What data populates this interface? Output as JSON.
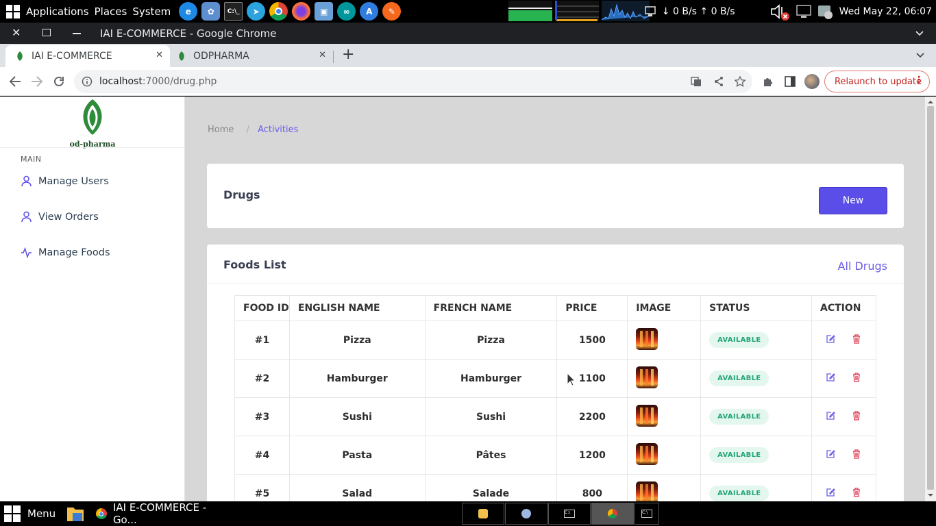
{
  "system_panel": {
    "menus": [
      "Applications",
      "Places",
      "System"
    ],
    "network": "↓ 0 B/s ↑ 0 B/s",
    "datetime": "Wed May 22, 06:07"
  },
  "window": {
    "title": "IAI E-COMMERCE - Google Chrome"
  },
  "tabs": [
    {
      "label": "IAI E-COMMERCE"
    },
    {
      "label": "ODPHARMA"
    }
  ],
  "address_bar": {
    "host": "localhost",
    "path": ":7000/drug.php",
    "relaunch_label": "Relaunch to update"
  },
  "sidebar": {
    "logo_text": "od-pharma",
    "section": "MAIN",
    "items": [
      {
        "label": "Manage Users",
        "icon": "user-icon"
      },
      {
        "label": "View Orders",
        "icon": "user-icon"
      },
      {
        "label": "Manage Foods",
        "icon": "activity-icon"
      }
    ]
  },
  "breadcrumb": {
    "home": "Home",
    "separator": "/",
    "current": "Activities"
  },
  "header_card": {
    "title": "Drugs",
    "new_button": "New"
  },
  "list_card": {
    "title": "Foods List",
    "link": "All Drugs",
    "columns": [
      "FOOD ID",
      "ENGLISH NAME",
      "FRENCH NAME",
      "PRICE",
      "IMAGE",
      "STATUS",
      "ACTION"
    ],
    "rows": [
      {
        "id": "#1",
        "english": "Pizza",
        "french": "Pizza",
        "price": "1500",
        "status": "AVAILABLE"
      },
      {
        "id": "#2",
        "english": "Hamburger",
        "french": "Hamburger",
        "price": "1100",
        "status": "AVAILABLE"
      },
      {
        "id": "#3",
        "english": "Sushi",
        "french": "Sushi",
        "price": "2200",
        "status": "AVAILABLE"
      },
      {
        "id": "#4",
        "english": "Pasta",
        "french": "Pâtes",
        "price": "1200",
        "status": "AVAILABLE"
      },
      {
        "id": "#5",
        "english": "Salad",
        "french": "Salade",
        "price": "800",
        "status": "AVAILABLE"
      }
    ]
  },
  "taskbar": {
    "menu_label": "Menu",
    "window_label": "IAI E-COMMERCE - Go..."
  },
  "colors": {
    "accent": "#5b4ee8",
    "available_bg": "#e3f7ef",
    "available_text": "#23a578",
    "delete": "#e0334d"
  }
}
